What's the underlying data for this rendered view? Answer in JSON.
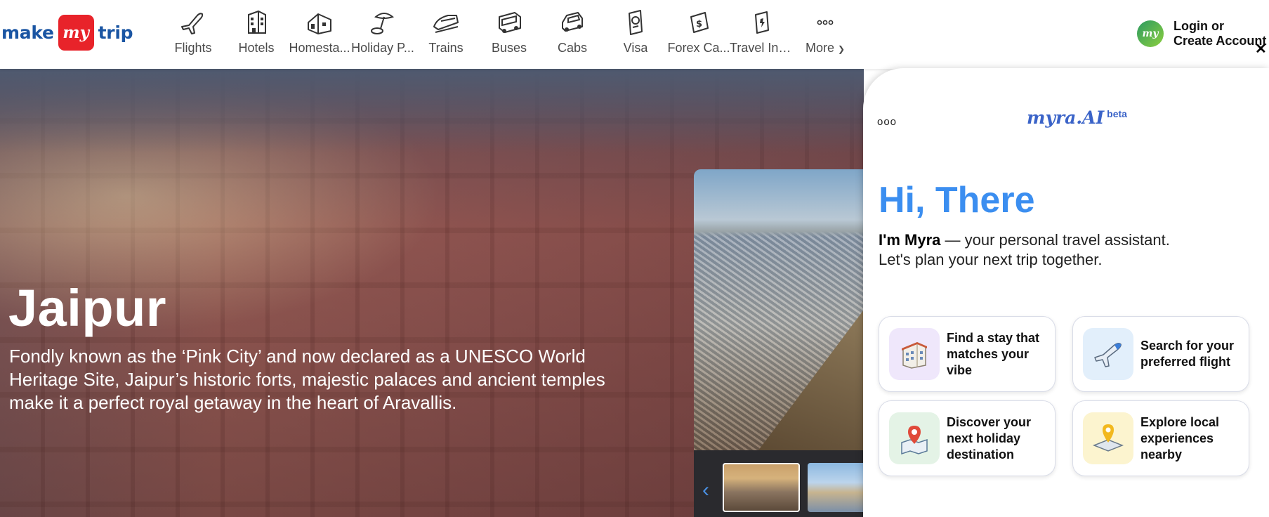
{
  "header": {
    "logo": {
      "left": "make",
      "badge": "my",
      "right": "trip"
    },
    "nav": [
      {
        "label": "Flights",
        "icon": "flight-icon"
      },
      {
        "label": "Hotels",
        "icon": "hotel-icon"
      },
      {
        "label": "Homesta...",
        "icon": "homestay-icon"
      },
      {
        "label": "Holiday P...",
        "icon": "holiday-package-icon"
      },
      {
        "label": "Trains",
        "icon": "train-icon"
      },
      {
        "label": "Buses",
        "icon": "bus-icon"
      },
      {
        "label": "Cabs",
        "icon": "cab-icon"
      },
      {
        "label": "Visa",
        "icon": "visa-icon"
      },
      {
        "label": "Forex Ca...",
        "icon": "forex-card-icon"
      },
      {
        "label": "Travel Ins...",
        "icon": "travel-insurance-icon"
      },
      {
        "label": "More",
        "icon": "more-icon"
      }
    ],
    "login": {
      "avatar": "my",
      "line1": "Login or",
      "line2": "Create Account"
    },
    "close_glyph": "✕"
  },
  "hero": {
    "title": "Jaipur",
    "description": "Fondly known as the ‘Pink City’ and now declared as a UNESCO World Heritage Site, Jaipur’s historic forts, majestic palaces and ancient temples make it a perfect royal getaway in the heart of Aravallis.",
    "thumb_prev_glyph": "‹"
  },
  "myra": {
    "menu_glyph": "ooo",
    "logo": "myra.AI",
    "badge": "beta",
    "greeting": "Hi, There",
    "intro_bold": "I'm Myra",
    "intro_rest": " — your personal travel assistant.",
    "intro_line2": "Let's plan your next trip together.",
    "cards": [
      {
        "text": "Find a stay that matches your vibe",
        "icon": "hotel-building-icon"
      },
      {
        "text": "Search for your preferred flight",
        "icon": "airplane-icon"
      },
      {
        "text": "Discover your next holiday destination",
        "icon": "map-pin-icon"
      },
      {
        "text": "Explore local experiences nearby",
        "icon": "location-pin-icon"
      }
    ]
  },
  "colors": {
    "brand_blue": "#1a55a3",
    "brand_red": "#e8232a",
    "myra_blue": "#3b8ef0"
  }
}
